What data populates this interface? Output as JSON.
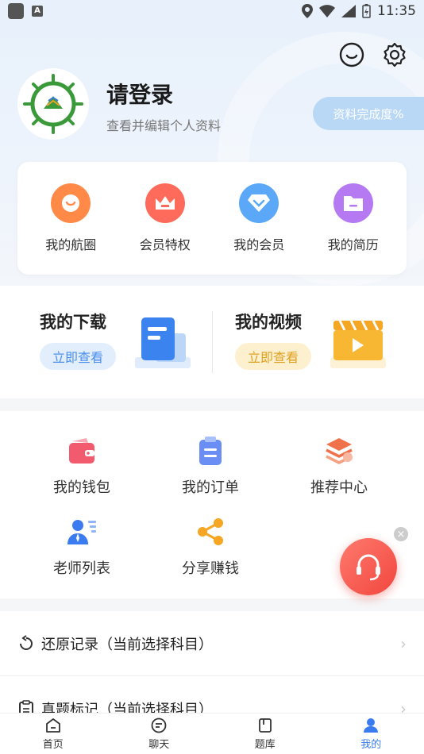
{
  "status": {
    "time": "11:35"
  },
  "profile": {
    "login_title": "请登录",
    "login_sub": "查看并编辑个人资料",
    "completion": "资料完成度%"
  },
  "member_items": [
    {
      "label": "我的航圈",
      "icon": "chat-smile-icon",
      "color": "#ff8a48"
    },
    {
      "label": "会员特权",
      "icon": "crown-icon",
      "color": "#ff6b5a"
    },
    {
      "label": "我的会员",
      "icon": "diamond-icon",
      "color": "#5aa8f7"
    },
    {
      "label": "我的简历",
      "icon": "folder-icon",
      "color": "#b57af2"
    }
  ],
  "download": {
    "title": "我的下载",
    "button": "立即查看"
  },
  "video": {
    "title": "我的视频",
    "button": "立即查看"
  },
  "grid_items": [
    {
      "label": "我的钱包",
      "icon": "wallet-icon"
    },
    {
      "label": "我的订单",
      "icon": "clipboard-icon"
    },
    {
      "label": "推荐中心",
      "icon": "layers-icon"
    },
    {
      "label": "老师列表",
      "icon": "teacher-icon"
    },
    {
      "label": "分享赚钱",
      "icon": "share-icon"
    }
  ],
  "list_items": [
    {
      "label": "还原记录（当前选择科目）",
      "icon": "restore-icon"
    },
    {
      "label": "真题标记（当前选择科目）",
      "icon": "mark-icon"
    }
  ],
  "tabs": [
    {
      "label": "首页",
      "icon": "home-icon"
    },
    {
      "label": "聊天",
      "icon": "chat-icon"
    },
    {
      "label": "题库",
      "icon": "book-icon"
    },
    {
      "label": "我的",
      "icon": "user-icon",
      "active": true
    }
  ]
}
